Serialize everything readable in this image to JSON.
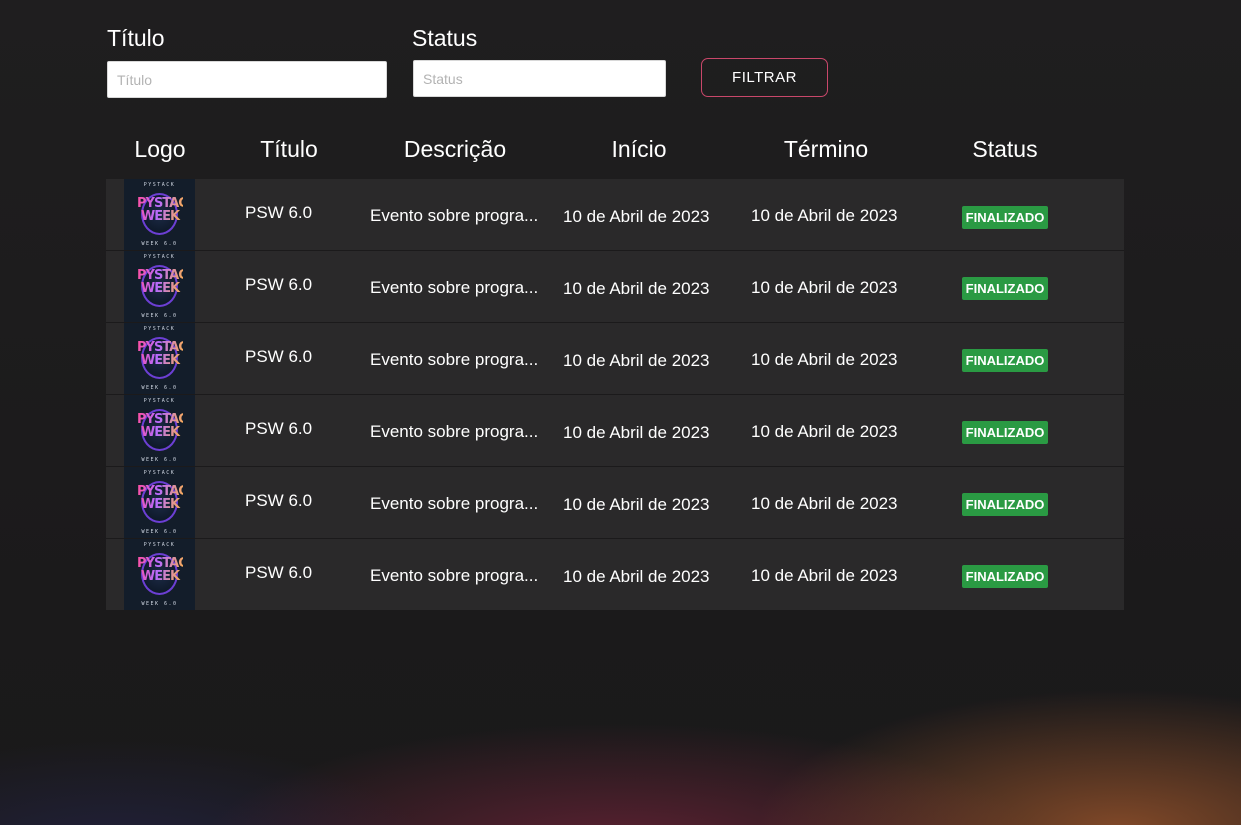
{
  "filters": {
    "title_label": "Título",
    "title_placeholder": "Título",
    "title_value": "",
    "status_label": "Status",
    "status_placeholder": "Status",
    "status_value": "",
    "filter_button": "FILTRAR"
  },
  "table": {
    "columns": [
      "Logo",
      "Título",
      "Descrição",
      "Início",
      "Término",
      "Status"
    ],
    "rows": [
      {
        "logo": {
          "top": "PYSTACK",
          "main": "PYSTACK WEEK",
          "bottom": "WEEK 6.0"
        },
        "title": "PSW 6.0",
        "description": "Evento sobre progra...",
        "start": "10 de Abril de 2023",
        "end": "10 de Abril de 2023",
        "status": "FINALIZADO"
      },
      {
        "logo": {
          "top": "PYSTACK",
          "main": "PYSTACK WEEK",
          "bottom": "WEEK 6.0"
        },
        "title": "PSW 6.0",
        "description": "Evento sobre progra...",
        "start": "10 de Abril de 2023",
        "end": "10 de Abril de 2023",
        "status": "FINALIZADO"
      },
      {
        "logo": {
          "top": "PYSTACK",
          "main": "PYSTACK WEEK",
          "bottom": "WEEK 6.0"
        },
        "title": "PSW 6.0",
        "description": "Evento sobre progra...",
        "start": "10 de Abril de 2023",
        "end": "10 de Abril de 2023",
        "status": "FINALIZADO"
      },
      {
        "logo": {
          "top": "PYSTACK",
          "main": "PYSTACK WEEK",
          "bottom": "WEEK 6.0"
        },
        "title": "PSW 6.0",
        "description": "Evento sobre progra...",
        "start": "10 de Abril de 2023",
        "end": "10 de Abril de 2023",
        "status": "FINALIZADO"
      },
      {
        "logo": {
          "top": "PYSTACK",
          "main": "PYSTACK WEEK",
          "bottom": "WEEK 6.0"
        },
        "title": "PSW 6.0",
        "description": "Evento sobre progra...",
        "start": "10 de Abril de 2023",
        "end": "10 de Abril de 2023",
        "status": "FINALIZADO"
      },
      {
        "logo": {
          "top": "PYSTACK",
          "main": "PYSTACK WEEK",
          "bottom": "WEEK 6.0"
        },
        "title": "PSW 6.0",
        "description": "Evento sobre progra...",
        "start": "10 de Abril de 2023",
        "end": "10 de Abril de 2023",
        "status": "FINALIZADO"
      }
    ]
  },
  "colors": {
    "background": "#1c1b1c",
    "row_background": "#2a292a",
    "status_finalizado": "#2a9a43",
    "button_border": "#c9476a"
  }
}
